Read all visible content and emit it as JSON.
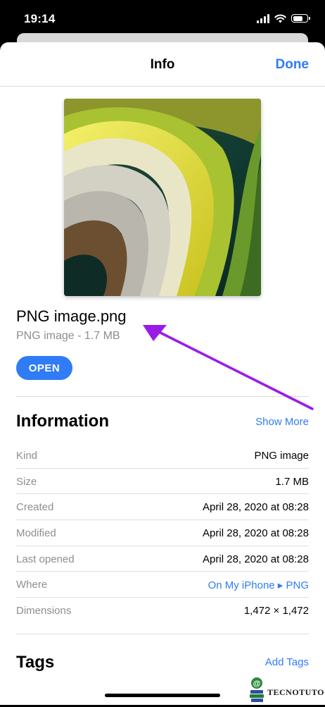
{
  "status_bar": {
    "time": "19:14",
    "battery_level": 0.8
  },
  "navbar": {
    "title": "Info",
    "done_label": "Done"
  },
  "file": {
    "name": "PNG image.png",
    "meta": "PNG image - 1.7 MB",
    "open_label": "OPEN"
  },
  "information": {
    "title": "Information",
    "show_more_label": "Show More",
    "rows": [
      {
        "label": "Kind",
        "value": "PNG image"
      },
      {
        "label": "Size",
        "value": "1.7 MB"
      },
      {
        "label": "Created",
        "value": "April 28, 2020 at 08:28"
      },
      {
        "label": "Modified",
        "value": "April 28, 2020 at 08:28"
      },
      {
        "label": "Last opened",
        "value": "April 28, 2020 at 08:28"
      },
      {
        "label": "Where",
        "value": "On My iPhone ▸ PNG"
      },
      {
        "label": "Dimensions",
        "value": "1,472 × 1,472"
      }
    ]
  },
  "tags": {
    "title": "Tags",
    "add_label": "Add Tags"
  },
  "watermark": {
    "text": "TECNOTUTO"
  },
  "colors": {
    "accent": "#2f7cf6",
    "annotation_arrow": "#9b1be6"
  }
}
